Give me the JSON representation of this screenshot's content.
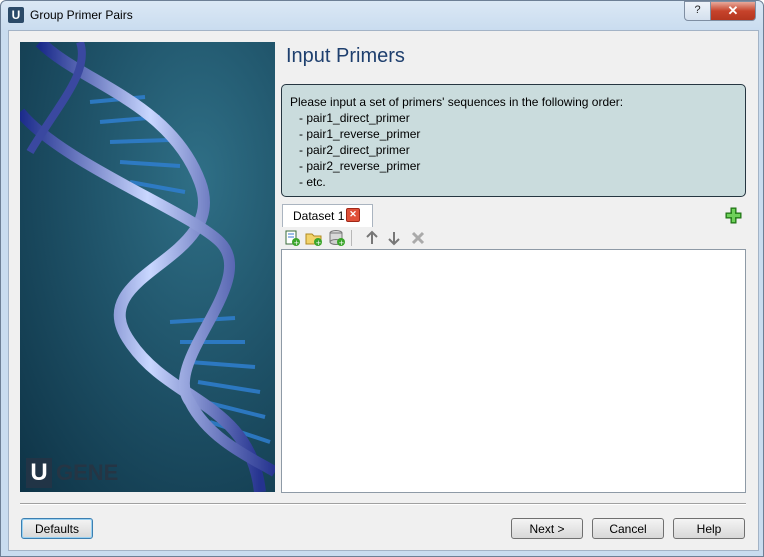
{
  "window": {
    "title": "Group Primer Pairs",
    "app_icon_letter": "U",
    "help_button": "?",
    "close_button": "✕"
  },
  "side_image": {
    "logo_letter": "U",
    "logo_text": "GENE"
  },
  "page": {
    "title": "Input Primers"
  },
  "info": {
    "lines": [
      "Please input a set of primers' sequences in the following order:",
      "- pair1_direct_primer",
      "- pair1_reverse_primer",
      "- pair2_direct_primer",
      "- pair2_reverse_primer",
      "- etc."
    ]
  },
  "datasets": {
    "tabs": [
      {
        "label": "Dataset 1"
      }
    ],
    "close_icon": "close-icon",
    "add_icon": "add-dataset-icon"
  },
  "toolbar": {
    "icons": [
      "add-file-icon",
      "add-folder-icon",
      "add-from-database-icon",
      "move-up-icon",
      "move-down-icon",
      "remove-icon"
    ]
  },
  "files_list": {
    "items": []
  },
  "buttons": {
    "defaults": "Defaults",
    "next": "Next >",
    "cancel": "Cancel",
    "help": "Help"
  },
  "colors": {
    "accent_title": "#1e3f6e",
    "info_box_bg": "#cadcdd",
    "close_red": "#c6432b"
  }
}
